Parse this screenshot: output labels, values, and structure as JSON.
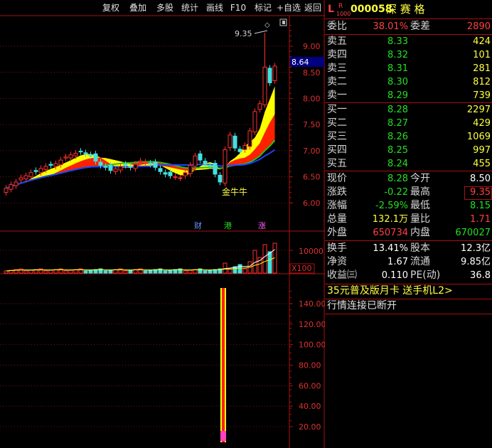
{
  "toolbar": {
    "buttons": [
      "复权",
      "叠加",
      "多股",
      "统计",
      "画线",
      "F10",
      "标记",
      "+自选",
      "返回"
    ]
  },
  "stock": {
    "market_letter": "L",
    "badge_top": "R",
    "badge_bottom": "1000",
    "code": "000058",
    "name": "深 赛 格"
  },
  "price_chart": {
    "y_ticks": [
      "9.00",
      "8.50",
      "8.00",
      "7.50",
      "7.00",
      "6.50",
      "6.00"
    ],
    "current_price_label": "8.64",
    "high_annotation": "9.35",
    "pattern_label": "金牛牛",
    "event_markers": [
      "财",
      "港",
      "涨"
    ]
  },
  "volume_chart": {
    "tick": "10000",
    "unit": "X100"
  },
  "indicator_chart": {
    "y_ticks": [
      "140.00",
      "120.00",
      "100.00",
      "80.00",
      "60.00",
      "40.00",
      "20.00"
    ]
  },
  "quote": {
    "weibi_label": "委比",
    "weibi": "38.01%",
    "weicha_label": "委差",
    "weicha": "2890",
    "asks": [
      {
        "label": "卖五",
        "price": "8.33",
        "vol": "424"
      },
      {
        "label": "卖四",
        "price": "8.32",
        "vol": "101"
      },
      {
        "label": "卖三",
        "price": "8.31",
        "vol": "281"
      },
      {
        "label": "卖二",
        "price": "8.30",
        "vol": "812"
      },
      {
        "label": "卖一",
        "price": "8.29",
        "vol": "739"
      }
    ],
    "bids": [
      {
        "label": "买一",
        "price": "8.28",
        "vol": "2297"
      },
      {
        "label": "买二",
        "price": "8.27",
        "vol": "429"
      },
      {
        "label": "买三",
        "price": "8.26",
        "vol": "1069"
      },
      {
        "label": "买四",
        "price": "8.25",
        "vol": "997"
      },
      {
        "label": "买五",
        "price": "8.24",
        "vol": "455"
      }
    ],
    "stats": [
      {
        "l1": "现价",
        "v1": "8.28",
        "c1": "green",
        "l2": "今开",
        "v2": "8.50",
        "c2": "white"
      },
      {
        "l1": "涨跌",
        "v1": "-0.22",
        "c1": "green",
        "l2": "最高",
        "v2": "9.35",
        "c2": "red"
      },
      {
        "l1": "涨幅",
        "v1": "-2.59%",
        "c1": "green",
        "l2": "最低",
        "v2": "8.15",
        "c2": "green"
      },
      {
        "l1": "总量",
        "v1": "132.1万",
        "c1": "yellow",
        "l2": "量比",
        "v2": "1.71",
        "c2": "red"
      },
      {
        "l1": "外盘",
        "v1": "650734",
        "c1": "red",
        "l2": "内盘",
        "v2": "670027",
        "c2": "green"
      }
    ],
    "stats2": [
      {
        "l1": "换手",
        "v1": "13.41%",
        "l2": "股本",
        "v2": "12.3亿"
      },
      {
        "l1": "净资",
        "v1": "1.67",
        "l2": "流通",
        "v2": "9.85亿"
      },
      {
        "l1": "收益㈢",
        "v1": "0.110",
        "l2": "PE(动)",
        "v2": "36.8"
      }
    ],
    "promo": "35元普及版月卡 送手机L2>",
    "status": "行情连接已断开"
  },
  "colors": {
    "up": "#ff3030",
    "down": "#44e0e0",
    "ma_yellow": "#ffff00",
    "ma_red": "#ff2000",
    "ma_blue": "#2040ff",
    "ma_green": "#20c020",
    "border": "#aa1010"
  }
}
